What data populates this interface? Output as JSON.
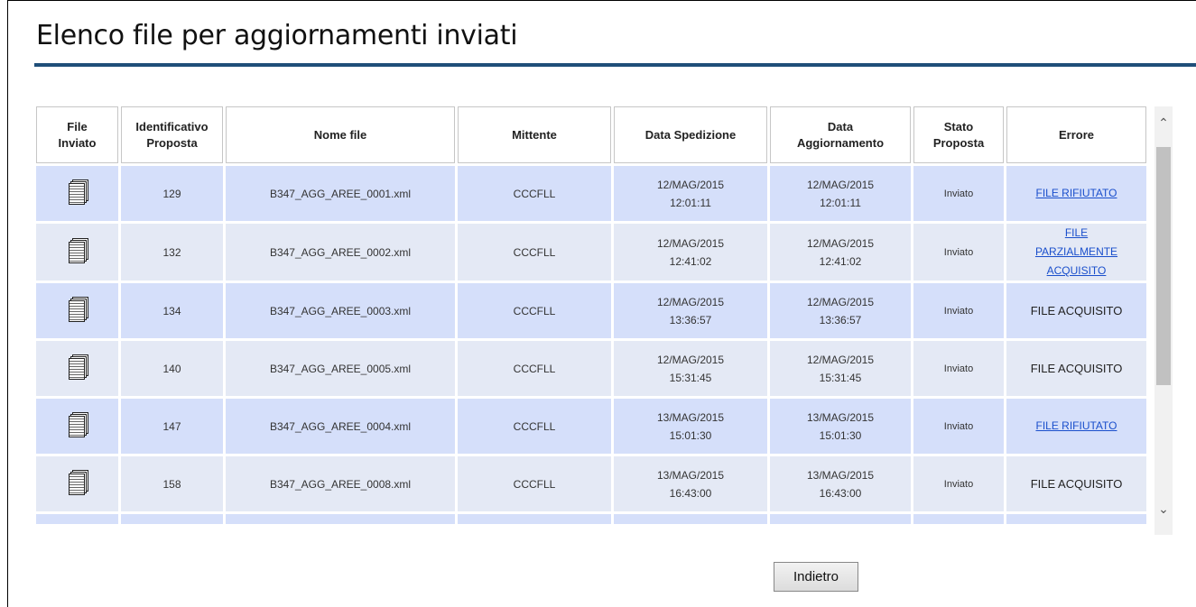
{
  "page": {
    "title": "Elenco file per aggiornamenti inviati"
  },
  "table": {
    "headers": {
      "file": [
        "File",
        "Inviato"
      ],
      "id": [
        "Identificativo",
        "Proposta"
      ],
      "nome": "Nome file",
      "mittente": "Mittente",
      "data_sped": "Data Spedizione",
      "data_agg": [
        "Data",
        "Aggiornamento"
      ],
      "stato": [
        "Stato",
        "Proposta"
      ],
      "errore": "Errore"
    },
    "rows": [
      {
        "icon": "document-stack-icon",
        "id": "129",
        "nome": "B347_AGG_AREE_0001.xml",
        "mittente": "CCCFLL",
        "sped_date": "12/MAG/2015",
        "sped_time": "12:01:11",
        "agg_date": "12/MAG/2015",
        "agg_time": "12:01:11",
        "stato": "Inviato",
        "errore": [
          "FILE RIFIUTATO"
        ],
        "errore_link": true
      },
      {
        "icon": "document-stack-icon",
        "id": "132",
        "nome": "B347_AGG_AREE_0002.xml",
        "mittente": "CCCFLL",
        "sped_date": "12/MAG/2015",
        "sped_time": "12:41:02",
        "agg_date": "12/MAG/2015",
        "agg_time": "12:41:02",
        "stato": "Inviato",
        "errore": [
          "FILE",
          "PARZIALMENTE",
          "ACQUISITO"
        ],
        "errore_link": true
      },
      {
        "icon": "document-stack-icon",
        "id": "134",
        "nome": "B347_AGG_AREE_0003.xml",
        "mittente": "CCCFLL",
        "sped_date": "12/MAG/2015",
        "sped_time": "13:36:57",
        "agg_date": "12/MAG/2015",
        "agg_time": "13:36:57",
        "stato": "Inviato",
        "errore": [
          "FILE ACQUISITO"
        ],
        "errore_link": false
      },
      {
        "icon": "document-stack-icon",
        "id": "140",
        "nome": "B347_AGG_AREE_0005.xml",
        "mittente": "CCCFLL",
        "sped_date": "12/MAG/2015",
        "sped_time": "15:31:45",
        "agg_date": "12/MAG/2015",
        "agg_time": "15:31:45",
        "stato": "Inviato",
        "errore": [
          "FILE ACQUISITO"
        ],
        "errore_link": false
      },
      {
        "icon": "document-stack-icon",
        "id": "147",
        "nome": "B347_AGG_AREE_0004.xml",
        "mittente": "CCCFLL",
        "sped_date": "13/MAG/2015",
        "sped_time": "15:01:30",
        "agg_date": "13/MAG/2015",
        "agg_time": "15:01:30",
        "stato": "Inviato",
        "errore": [
          "FILE RIFIUTATO"
        ],
        "errore_link": true
      },
      {
        "icon": "document-stack-icon",
        "id": "158",
        "nome": "B347_AGG_AREE_0008.xml",
        "mittente": "CCCFLL",
        "sped_date": "13/MAG/2015",
        "sped_time": "16:43:00",
        "agg_date": "13/MAG/2015",
        "agg_time": "16:43:00",
        "stato": "Inviato",
        "errore": [
          "FILE ACQUISITO"
        ],
        "errore_link": false
      }
    ]
  },
  "scrollbar": {
    "up_icon": "chevron-up-icon",
    "down_icon": "chevron-down-icon"
  },
  "footer": {
    "back_label": "Indietro"
  },
  "colors": {
    "title_rule": "#1f4e79",
    "row_odd": "#d5dffa",
    "row_even": "#e4e9f5",
    "link": "#1a4fcc"
  }
}
